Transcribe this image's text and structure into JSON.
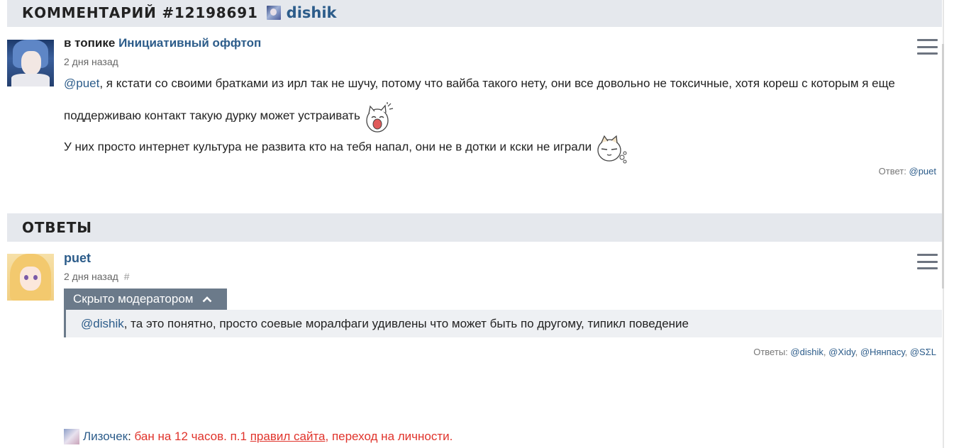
{
  "comment": {
    "header_title": "КОММЕНТАРИЙ #12198691",
    "author": "dishik",
    "topic_prefix": "в топике",
    "topic_name": "Инициативный оффтоп",
    "date": "2 дня назад",
    "line1_mention": "@puet",
    "line1_text": ", я кстати со своими братками из ирл так не шучу, потому что вайба такого нету, они все довольно не токсичные, хотя кореш с которым я еще",
    "line2_text": "поддерживаю контакт такую дурку может устраивать",
    "line3_text": "У них просто интернет культура не развита кто на тебя напал, они не в дотки и кски не играли",
    "reply_label": "Ответ:",
    "reply_user": "@puet"
  },
  "answers_section": {
    "header_title": "ОТВЕТЫ"
  },
  "reply": {
    "author": "puet",
    "date": "2 дня назад",
    "hash": "#",
    "hidden_label": "Скрыто модератором",
    "mention": "@dishik",
    "text": ", та это понятно, просто соевые моралфаги удивлены что может быть по другому, типикл поведение",
    "answers_label": "Ответы:",
    "answers": [
      "@dishik",
      "@Xidy",
      "@Нянпасу",
      "@SΣL"
    ]
  },
  "ban": {
    "moderator": "Лизочек",
    "colon": ":",
    "text1": " бан на 12 часов. п.1 ",
    "rules_link": "правил сайта",
    "text2": ", переход на личности."
  },
  "icons": {
    "menu": "hamburger-menu-icon",
    "collapse": "chevron-up-icon"
  },
  "colors": {
    "link": "#2c5c8a",
    "header_bg": "#e5e8ed",
    "hidden_bar": "#6b7a8a",
    "ban_red": "#e0332b"
  }
}
